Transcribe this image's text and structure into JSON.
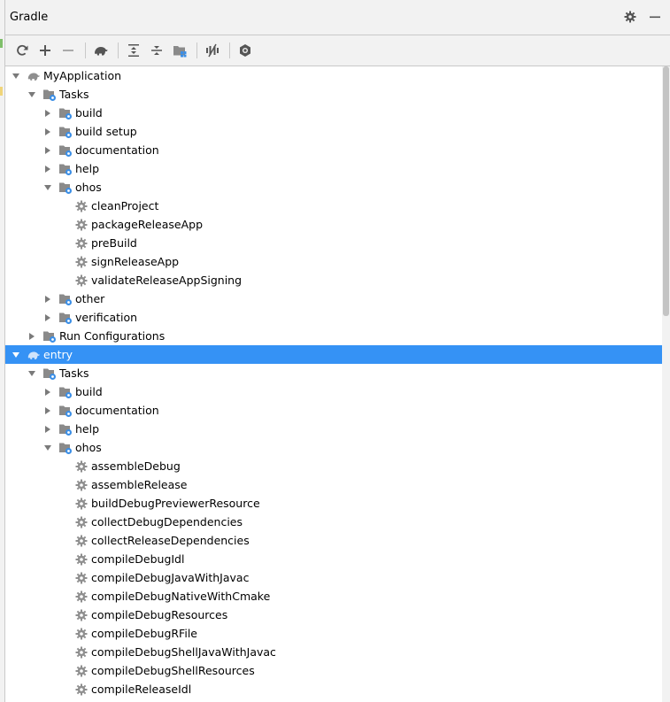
{
  "window": {
    "title": "Gradle"
  },
  "title_actions": [
    "gear-icon",
    "minimize-icon"
  ],
  "toolbar": [
    "refresh-icon",
    "add-icon",
    "remove-icon",
    "sep",
    "elephant-icon",
    "sep",
    "expand-all-icon",
    "collapse-all-icon",
    "group-modules-icon",
    "sep",
    "toggle-offline-icon",
    "sep",
    "settings-icon"
  ],
  "colors": {
    "selection": "#3592f5",
    "panel": "#f2f2f2",
    "tree_bg": "#ffffff",
    "icon_blue": "#3a8ee6"
  },
  "tree": [
    {
      "label": "MyApplication",
      "depth": 0,
      "expanded": true,
      "icon": "gradle-project-icon"
    },
    {
      "label": "Tasks",
      "depth": 1,
      "expanded": true,
      "icon": "task-folder-icon"
    },
    {
      "label": "build",
      "depth": 2,
      "expanded": false,
      "icon": "task-folder-icon"
    },
    {
      "label": "build setup",
      "depth": 2,
      "expanded": false,
      "icon": "task-folder-icon"
    },
    {
      "label": "documentation",
      "depth": 2,
      "expanded": false,
      "icon": "task-folder-icon"
    },
    {
      "label": "help",
      "depth": 2,
      "expanded": false,
      "icon": "task-folder-icon"
    },
    {
      "label": "ohos",
      "depth": 2,
      "expanded": true,
      "icon": "task-folder-icon"
    },
    {
      "label": "cleanProject",
      "depth": 3,
      "icon": "task-gear-icon"
    },
    {
      "label": "packageReleaseApp",
      "depth": 3,
      "icon": "task-gear-icon"
    },
    {
      "label": "preBuild",
      "depth": 3,
      "icon": "task-gear-icon"
    },
    {
      "label": "signReleaseApp",
      "depth": 3,
      "icon": "task-gear-icon"
    },
    {
      "label": "validateReleaseAppSigning",
      "depth": 3,
      "icon": "task-gear-icon"
    },
    {
      "label": "other",
      "depth": 2,
      "expanded": false,
      "icon": "task-folder-icon"
    },
    {
      "label": "verification",
      "depth": 2,
      "expanded": false,
      "icon": "task-folder-icon"
    },
    {
      "label": "Run Configurations",
      "depth": 1,
      "expanded": false,
      "icon": "task-folder-icon"
    },
    {
      "label": "entry",
      "depth": 0,
      "expanded": true,
      "icon": "gradle-project-icon",
      "selected": true
    },
    {
      "label": "Tasks",
      "depth": 1,
      "expanded": true,
      "icon": "task-folder-icon"
    },
    {
      "label": "build",
      "depth": 2,
      "expanded": false,
      "icon": "task-folder-icon"
    },
    {
      "label": "documentation",
      "depth": 2,
      "expanded": false,
      "icon": "task-folder-icon"
    },
    {
      "label": "help",
      "depth": 2,
      "expanded": false,
      "icon": "task-folder-icon"
    },
    {
      "label": "ohos",
      "depth": 2,
      "expanded": true,
      "icon": "task-folder-icon"
    },
    {
      "label": "assembleDebug",
      "depth": 3,
      "icon": "task-gear-icon"
    },
    {
      "label": "assembleRelease",
      "depth": 3,
      "icon": "task-gear-icon"
    },
    {
      "label": "buildDebugPreviewerResource",
      "depth": 3,
      "icon": "task-gear-icon"
    },
    {
      "label": "collectDebugDependencies",
      "depth": 3,
      "icon": "task-gear-icon"
    },
    {
      "label": "collectReleaseDependencies",
      "depth": 3,
      "icon": "task-gear-icon"
    },
    {
      "label": "compileDebugIdl",
      "depth": 3,
      "icon": "task-gear-icon"
    },
    {
      "label": "compileDebugJavaWithJavac",
      "depth": 3,
      "icon": "task-gear-icon"
    },
    {
      "label": "compileDebugNativeWithCmake",
      "depth": 3,
      "icon": "task-gear-icon"
    },
    {
      "label": "compileDebugResources",
      "depth": 3,
      "icon": "task-gear-icon"
    },
    {
      "label": "compileDebugRFile",
      "depth": 3,
      "icon": "task-gear-icon"
    },
    {
      "label": "compileDebugShellJavaWithJavac",
      "depth": 3,
      "icon": "task-gear-icon"
    },
    {
      "label": "compileDebugShellResources",
      "depth": 3,
      "icon": "task-gear-icon"
    },
    {
      "label": "compileReleaseIdl",
      "depth": 3,
      "icon": "task-gear-icon"
    }
  ]
}
